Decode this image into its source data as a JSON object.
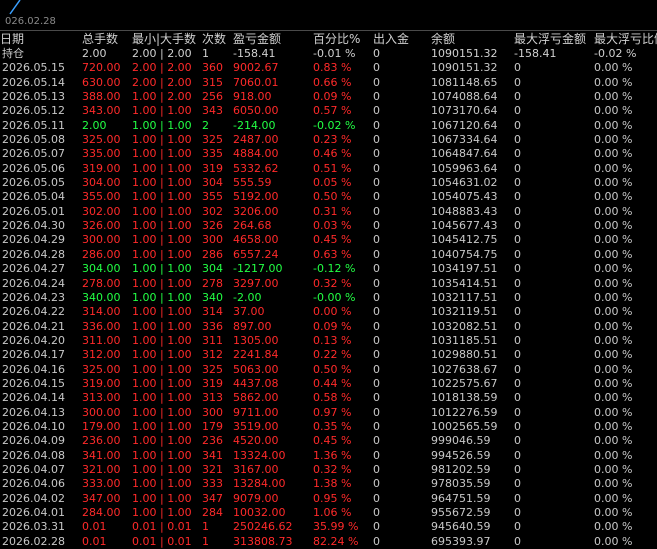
{
  "window": {
    "date_stamp": "026.02.28"
  },
  "columns": [
    "日期",
    "总手数",
    "最小|大手数",
    "次数",
    "盈亏金额",
    "百分比%",
    "出入金",
    "余额",
    "最大浮亏金额",
    "最大浮亏比例"
  ],
  "rows": [
    {
      "date": "持仓",
      "lots": "2.00",
      "minmax": "2.00 | 2.00",
      "count": "1",
      "pnl": "-158.41",
      "pct": "-0.01 %",
      "flow": "0",
      "balance": "1090151.32",
      "maxloss": "-158.41",
      "maxpct": "-0.02 %",
      "dir": "down"
    },
    {
      "date": "2026.05.15",
      "lots": "720.00",
      "minmax": "2.00 | 2.00",
      "count": "360",
      "pnl": "9002.67",
      "pct": "0.83 %",
      "flow": "0",
      "balance": "1090151.32",
      "maxloss": "0",
      "maxpct": "0.00 %",
      "dir": "up"
    },
    {
      "date": "2026.05.14",
      "lots": "630.00",
      "minmax": "2.00 | 2.00",
      "count": "315",
      "pnl": "7060.01",
      "pct": "0.66 %",
      "flow": "0",
      "balance": "1081148.65",
      "maxloss": "0",
      "maxpct": "0.00 %",
      "dir": "up"
    },
    {
      "date": "2026.05.13",
      "lots": "388.00",
      "minmax": "1.00 | 2.00",
      "count": "256",
      "pnl": "918.00",
      "pct": "0.09 %",
      "flow": "0",
      "balance": "1074088.64",
      "maxloss": "0",
      "maxpct": "0.00 %",
      "dir": "up"
    },
    {
      "date": "2026.05.12",
      "lots": "343.00",
      "minmax": "1.00 | 1.00",
      "count": "343",
      "pnl": "6050.00",
      "pct": "0.57 %",
      "flow": "0",
      "balance": "1073170.64",
      "maxloss": "0",
      "maxpct": "0.00 %",
      "dir": "up"
    },
    {
      "date": "2026.05.11",
      "lots": "2.00",
      "minmax": "1.00 | 1.00",
      "count": "2",
      "pnl": "-214.00",
      "pct": "-0.02 %",
      "flow": "0",
      "balance": "1067120.64",
      "maxloss": "0",
      "maxpct": "0.00 %",
      "dir": "down"
    },
    {
      "date": "2026.05.08",
      "lots": "325.00",
      "minmax": "1.00 | 1.00",
      "count": "325",
      "pnl": "2487.00",
      "pct": "0.23 %",
      "flow": "0",
      "balance": "1067334.64",
      "maxloss": "0",
      "maxpct": "0.00 %",
      "dir": "up"
    },
    {
      "date": "2026.05.07",
      "lots": "335.00",
      "minmax": "1.00 | 1.00",
      "count": "335",
      "pnl": "4884.00",
      "pct": "0.46 %",
      "flow": "0",
      "balance": "1064847.64",
      "maxloss": "0",
      "maxpct": "0.00 %",
      "dir": "up"
    },
    {
      "date": "2026.05.06",
      "lots": "319.00",
      "minmax": "1.00 | 1.00",
      "count": "319",
      "pnl": "5332.62",
      "pct": "0.51 %",
      "flow": "0",
      "balance": "1059963.64",
      "maxloss": "0",
      "maxpct": "0.00 %",
      "dir": "up"
    },
    {
      "date": "2026.05.05",
      "lots": "304.00",
      "minmax": "1.00 | 1.00",
      "count": "304",
      "pnl": "555.59",
      "pct": "0.05 %",
      "flow": "0",
      "balance": "1054631.02",
      "maxloss": "0",
      "maxpct": "0.00 %",
      "dir": "up"
    },
    {
      "date": "2026.05.04",
      "lots": "355.00",
      "minmax": "1.00 | 1.00",
      "count": "355",
      "pnl": "5192.00",
      "pct": "0.50 %",
      "flow": "0",
      "balance": "1054075.43",
      "maxloss": "0",
      "maxpct": "0.00 %",
      "dir": "up"
    },
    {
      "date": "2026.05.01",
      "lots": "302.00",
      "minmax": "1.00 | 1.00",
      "count": "302",
      "pnl": "3206.00",
      "pct": "0.31 %",
      "flow": "0",
      "balance": "1048883.43",
      "maxloss": "0",
      "maxpct": "0.00 %",
      "dir": "up"
    },
    {
      "date": "2026.04.30",
      "lots": "326.00",
      "minmax": "1.00 | 1.00",
      "count": "326",
      "pnl": "264.68",
      "pct": "0.03 %",
      "flow": "0",
      "balance": "1045677.43",
      "maxloss": "0",
      "maxpct": "0.00 %",
      "dir": "up"
    },
    {
      "date": "2026.04.29",
      "lots": "300.00",
      "minmax": "1.00 | 1.00",
      "count": "300",
      "pnl": "4658.00",
      "pct": "0.45 %",
      "flow": "0",
      "balance": "1045412.75",
      "maxloss": "0",
      "maxpct": "0.00 %",
      "dir": "up"
    },
    {
      "date": "2026.04.28",
      "lots": "286.00",
      "minmax": "1.00 | 1.00",
      "count": "286",
      "pnl": "6557.24",
      "pct": "0.63 %",
      "flow": "0",
      "balance": "1040754.75",
      "maxloss": "0",
      "maxpct": "0.00 %",
      "dir": "up"
    },
    {
      "date": "2026.04.27",
      "lots": "304.00",
      "minmax": "1.00 | 1.00",
      "count": "304",
      "pnl": "-1217.00",
      "pct": "-0.12 %",
      "flow": "0",
      "balance": "1034197.51",
      "maxloss": "0",
      "maxpct": "0.00 %",
      "dir": "down"
    },
    {
      "date": "2026.04.24",
      "lots": "278.00",
      "minmax": "1.00 | 1.00",
      "count": "278",
      "pnl": "3297.00",
      "pct": "0.32 %",
      "flow": "0",
      "balance": "1035414.51",
      "maxloss": "0",
      "maxpct": "0.00 %",
      "dir": "up"
    },
    {
      "date": "2026.04.23",
      "lots": "340.00",
      "minmax": "1.00 | 1.00",
      "count": "340",
      "pnl": "-2.00",
      "pct": "-0.00 %",
      "flow": "0",
      "balance": "1032117.51",
      "maxloss": "0",
      "maxpct": "0.00 %",
      "dir": "down"
    },
    {
      "date": "2026.04.22",
      "lots": "314.00",
      "minmax": "1.00 | 1.00",
      "count": "314",
      "pnl": "37.00",
      "pct": "0.00 %",
      "flow": "0",
      "balance": "1032119.51",
      "maxloss": "0",
      "maxpct": "0.00 %",
      "dir": "up"
    },
    {
      "date": "2026.04.21",
      "lots": "336.00",
      "minmax": "1.00 | 1.00",
      "count": "336",
      "pnl": "897.00",
      "pct": "0.09 %",
      "flow": "0",
      "balance": "1032082.51",
      "maxloss": "0",
      "maxpct": "0.00 %",
      "dir": "up"
    },
    {
      "date": "2026.04.20",
      "lots": "311.00",
      "minmax": "1.00 | 1.00",
      "count": "311",
      "pnl": "1305.00",
      "pct": "0.13 %",
      "flow": "0",
      "balance": "1031185.51",
      "maxloss": "0",
      "maxpct": "0.00 %",
      "dir": "up"
    },
    {
      "date": "2026.04.17",
      "lots": "312.00",
      "minmax": "1.00 | 1.00",
      "count": "312",
      "pnl": "2241.84",
      "pct": "0.22 %",
      "flow": "0",
      "balance": "1029880.51",
      "maxloss": "0",
      "maxpct": "0.00 %",
      "dir": "up"
    },
    {
      "date": "2026.04.16",
      "lots": "325.00",
      "minmax": "1.00 | 1.00",
      "count": "325",
      "pnl": "5063.00",
      "pct": "0.50 %",
      "flow": "0",
      "balance": "1027638.67",
      "maxloss": "0",
      "maxpct": "0.00 %",
      "dir": "up"
    },
    {
      "date": "2026.04.15",
      "lots": "319.00",
      "minmax": "1.00 | 1.00",
      "count": "319",
      "pnl": "4437.08",
      "pct": "0.44 %",
      "flow": "0",
      "balance": "1022575.67",
      "maxloss": "0",
      "maxpct": "0.00 %",
      "dir": "up"
    },
    {
      "date": "2026.04.14",
      "lots": "313.00",
      "minmax": "1.00 | 1.00",
      "count": "313",
      "pnl": "5862.00",
      "pct": "0.58 %",
      "flow": "0",
      "balance": "1018138.59",
      "maxloss": "0",
      "maxpct": "0.00 %",
      "dir": "up"
    },
    {
      "date": "2026.04.13",
      "lots": "300.00",
      "minmax": "1.00 | 1.00",
      "count": "300",
      "pnl": "9711.00",
      "pct": "0.97 %",
      "flow": "0",
      "balance": "1012276.59",
      "maxloss": "0",
      "maxpct": "0.00 %",
      "dir": "up"
    },
    {
      "date": "2026.04.10",
      "lots": "179.00",
      "minmax": "1.00 | 1.00",
      "count": "179",
      "pnl": "3519.00",
      "pct": "0.35 %",
      "flow": "0",
      "balance": "1002565.59",
      "maxloss": "0",
      "maxpct": "0.00 %",
      "dir": "up"
    },
    {
      "date": "2026.04.09",
      "lots": "236.00",
      "minmax": "1.00 | 1.00",
      "count": "236",
      "pnl": "4520.00",
      "pct": "0.45 %",
      "flow": "0",
      "balance": "999046.59",
      "maxloss": "0",
      "maxpct": "0.00 %",
      "dir": "up"
    },
    {
      "date": "2026.04.08",
      "lots": "341.00",
      "minmax": "1.00 | 1.00",
      "count": "341",
      "pnl": "13324.00",
      "pct": "1.36 %",
      "flow": "0",
      "balance": "994526.59",
      "maxloss": "0",
      "maxpct": "0.00 %",
      "dir": "up"
    },
    {
      "date": "2026.04.07",
      "lots": "321.00",
      "minmax": "1.00 | 1.00",
      "count": "321",
      "pnl": "3167.00",
      "pct": "0.32 %",
      "flow": "0",
      "balance": "981202.59",
      "maxloss": "0",
      "maxpct": "0.00 %",
      "dir": "up"
    },
    {
      "date": "2026.04.06",
      "lots": "333.00",
      "minmax": "1.00 | 1.00",
      "count": "333",
      "pnl": "13284.00",
      "pct": "1.38 %",
      "flow": "0",
      "balance": "978035.59",
      "maxloss": "0",
      "maxpct": "0.00 %",
      "dir": "up"
    },
    {
      "date": "2026.04.02",
      "lots": "347.00",
      "minmax": "1.00 | 1.00",
      "count": "347",
      "pnl": "9079.00",
      "pct": "0.95 %",
      "flow": "0",
      "balance": "964751.59",
      "maxloss": "0",
      "maxpct": "0.00 %",
      "dir": "up"
    },
    {
      "date": "2026.04.01",
      "lots": "284.00",
      "minmax": "1.00 | 1.00",
      "count": "284",
      "pnl": "10032.00",
      "pct": "1.06 %",
      "flow": "0",
      "balance": "955672.59",
      "maxloss": "0",
      "maxpct": "0.00 %",
      "dir": "up"
    },
    {
      "date": "2026.03.31",
      "lots": "0.01",
      "minmax": "0.01 | 0.01",
      "count": "1",
      "pnl": "250246.62",
      "pct": "35.99 %",
      "flow": "0",
      "balance": "945640.59",
      "maxloss": "0",
      "maxpct": "0.00 %",
      "dir": "up"
    },
    {
      "date": "2026.02.28",
      "lots": "0.01",
      "minmax": "0.01 | 0.01",
      "count": "1",
      "pnl": "313808.73",
      "pct": "82.24 %",
      "flow": "0",
      "balance": "695393.97",
      "maxloss": "0",
      "maxpct": "0.00 %",
      "dir": "up"
    }
  ],
  "colors": {
    "up": "#ff2a2a",
    "down": "#22ff44",
    "neutral": "#c8c8c8",
    "background": "#000000"
  }
}
